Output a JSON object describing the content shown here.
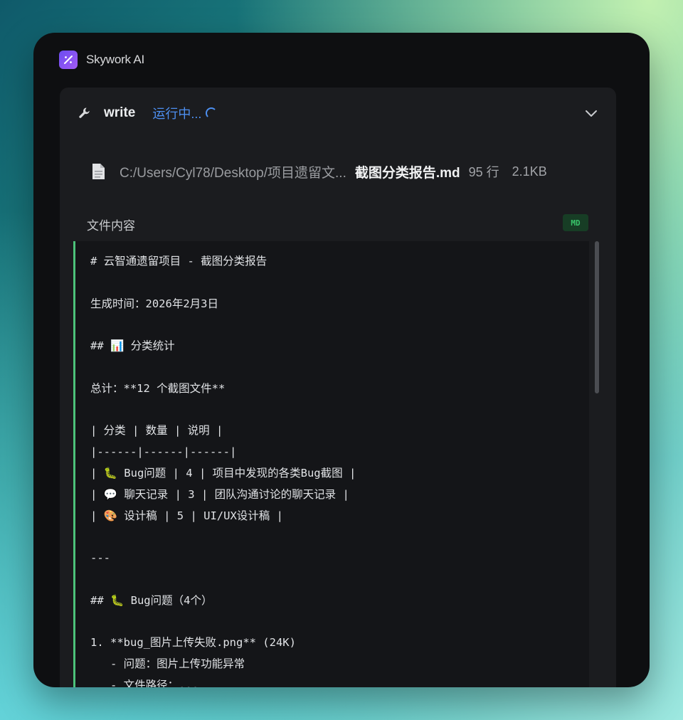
{
  "app": {
    "title": "Skywork AI",
    "logo_icon": "skywork-logo-icon"
  },
  "tool": {
    "name": "write",
    "status": "运行中...",
    "icon": "wrench-icon",
    "status_color": "#4d8ff0",
    "expand_icon": "chevron-down-icon"
  },
  "file": {
    "icon": "document-icon",
    "path": "C:/Users/Cyl78/Desktop/项目遗留文...",
    "name": "截图分类报告.md",
    "lines": "95 行",
    "size": "2.1KB"
  },
  "content": {
    "label": "文件内容",
    "badge": "MD",
    "accent_color": "#4cc27a",
    "lines": [
      "# 云智通遗留项目 - 截图分类报告",
      "",
      "生成时间：2026年2月3日",
      "",
      "## 📊 分类统计",
      "",
      "总计：**12 个截图文件**",
      "",
      "| 分类 | 数量 | 说明 |",
      "|------|------|------|",
      "| 🐛 Bug问题 | 4 | 项目中发现的各类Bug截图 |",
      "| 💬 聊天记录 | 3 | 团队沟通讨论的聊天记录 |",
      "| 🎨 设计稿 | 5 | UI/UX设计稿 |",
      "",
      "---",
      "",
      "## 🐛 Bug问题（4个）",
      "",
      "1. **bug_图片上传失败.png** (24K)",
      "   - 问题：图片上传功能异常",
      "   - 文件路径：..."
    ]
  }
}
